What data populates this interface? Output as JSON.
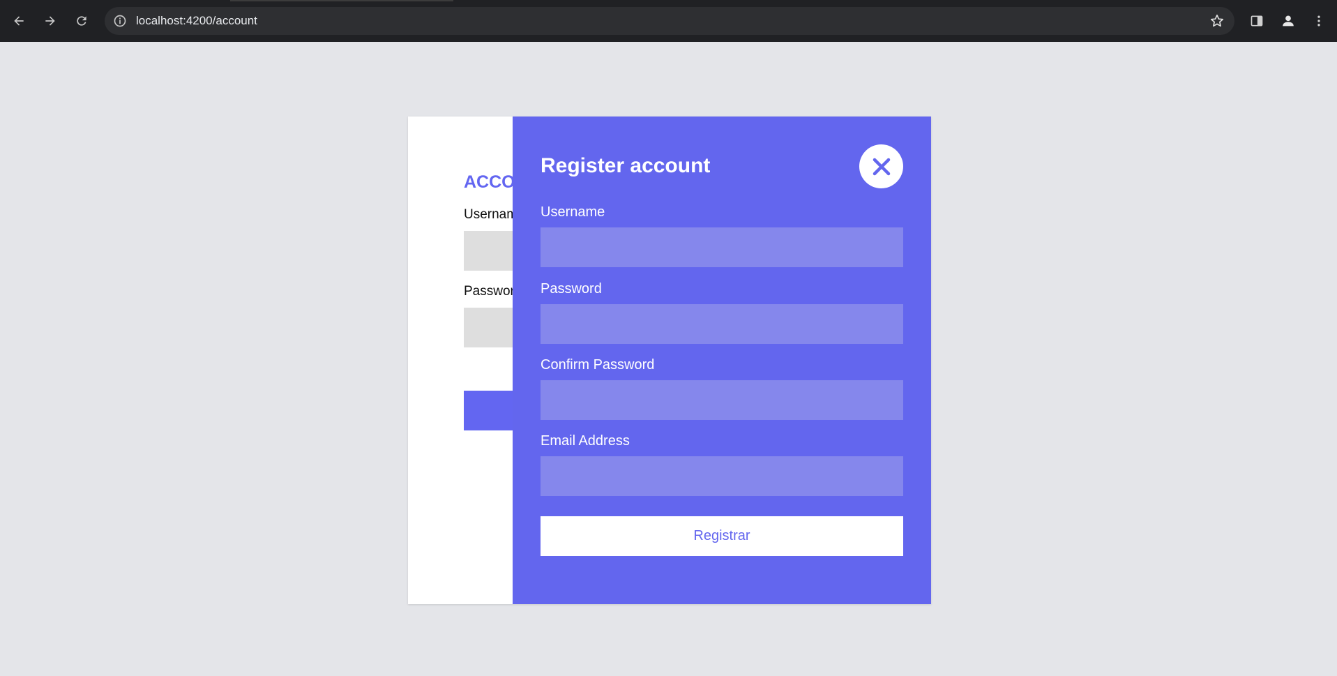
{
  "browser": {
    "url": "localhost:4200/account",
    "icons": {
      "back": "arrow-left-icon",
      "forward": "arrow-right-icon",
      "reload": "reload-icon",
      "site_info": "info-icon",
      "bookmark": "star-icon",
      "side_panel": "side-panel-icon",
      "profile": "profile-icon",
      "menu": "kebab-menu-icon"
    }
  },
  "login": {
    "title": "ACCOUNT",
    "username_label": "Username",
    "password_label": "Password"
  },
  "register": {
    "heading": "Register account",
    "fields": {
      "username_label": "Username",
      "password_label": "Password",
      "confirm_password_label": "Confirm Password",
      "email_label": "Email Address"
    },
    "submit_label": "Registrar",
    "close_icon": "close-icon"
  },
  "colors": {
    "accent": "#6366ee",
    "input_fill": "#8587ec",
    "page_bg": "#e4e5e9",
    "chrome_bg": "#202124"
  }
}
